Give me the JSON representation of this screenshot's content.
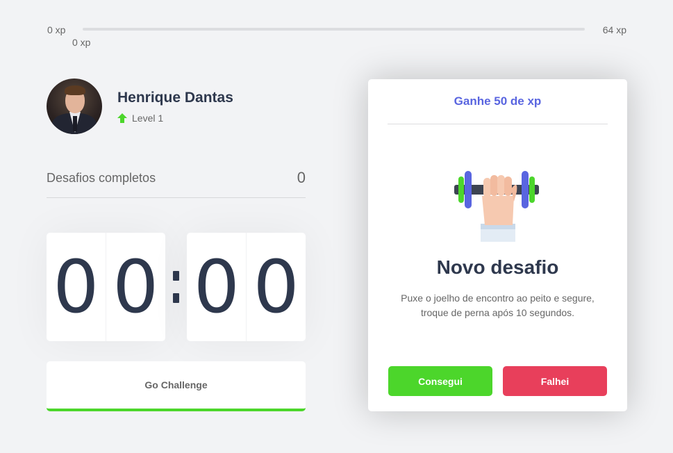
{
  "experience": {
    "min_label": "0 xp",
    "max_label": "64 xp",
    "current_label": "0 xp",
    "progress_percent": 0,
    "bar_color": "#4cd62b"
  },
  "profile": {
    "name": "Henrique Dantas",
    "level_label": "Level 1",
    "level_icon": "arrow-up-icon"
  },
  "completed": {
    "label": "Desafios completos",
    "count": "0"
  },
  "countdown": {
    "minute_left": "0",
    "minute_right": "0",
    "second_left": "0",
    "second_right": "0"
  },
  "go_button": {
    "label": "Go Challenge"
  },
  "challenge": {
    "header": "Ganhe 50 de xp",
    "icon": "dumbbell-icon",
    "title": "Novo desafio",
    "description": "Puxe o joelho de encontro ao peito e segure, troque de perna após 10 segundos.",
    "success_label": "Consegui",
    "fail_label": "Falhei",
    "colors": {
      "accent": "#5965e0",
      "success": "#4cd62b",
      "fail": "#e83f5b"
    }
  }
}
